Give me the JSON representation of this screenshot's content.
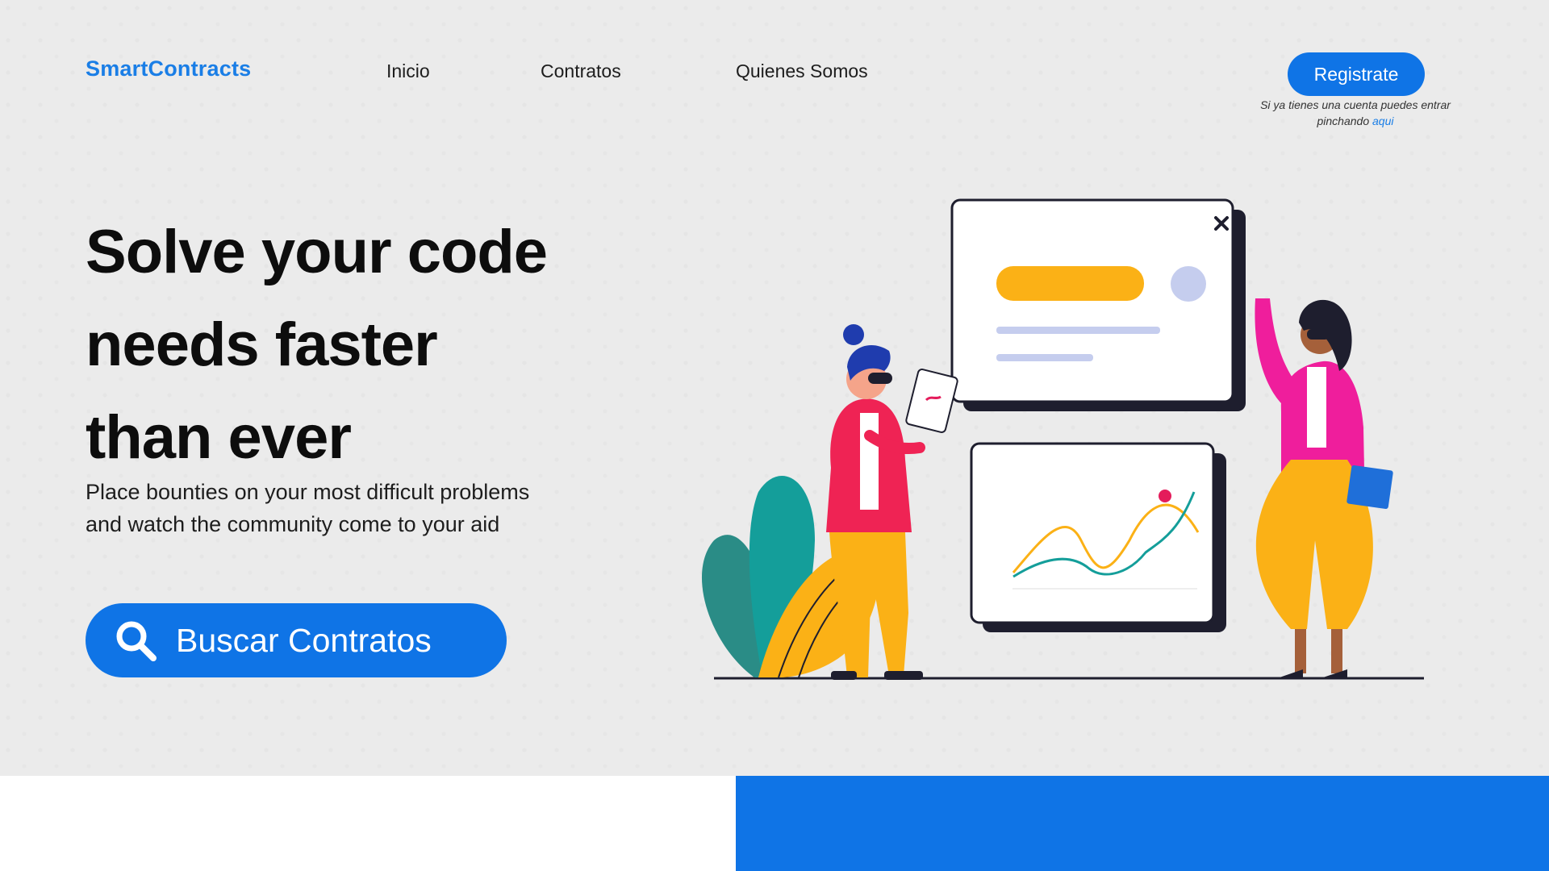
{
  "header": {
    "logo": "SmartContracts",
    "nav": [
      "Inicio",
      "Contratos",
      "Quienes Somos"
    ],
    "register_label": "Registrate",
    "login_hint_prefix": "Si ya tienes una cuenta puedes entrar pinchando ",
    "login_link": "aqui"
  },
  "hero": {
    "headline_lines": [
      "Solve your code",
      "needs faster",
      "than ever"
    ],
    "subtitle_lines": [
      "Place bounties on your most difficult problems",
      "and watch the community come to your aid"
    ],
    "search_button_label": "Buscar Contratos"
  },
  "colors": {
    "accent": "#0f74e6",
    "logo": "#1a7ee6",
    "background": "#ebebeb"
  }
}
